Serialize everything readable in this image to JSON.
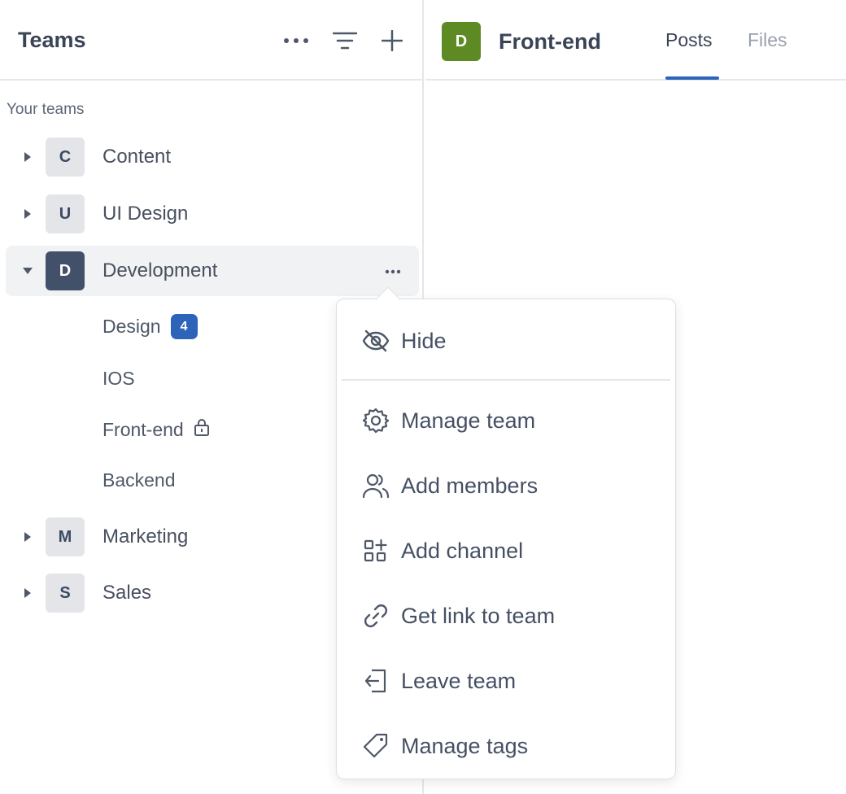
{
  "sidebar": {
    "title": "Teams",
    "section_label": "Your teams",
    "teams": [
      {
        "initial": "C",
        "name": "Content"
      },
      {
        "initial": "U",
        "name": "UI Design"
      },
      {
        "initial": "D",
        "name": "Development"
      },
      {
        "initial": "M",
        "name": "Marketing"
      },
      {
        "initial": "S",
        "name": "Sales"
      }
    ],
    "channels": [
      {
        "name": "Design",
        "badge": "4"
      },
      {
        "name": "IOS"
      },
      {
        "name": "Front-end",
        "locked": true
      },
      {
        "name": "Backend"
      }
    ]
  },
  "main": {
    "avatar_initial": "D",
    "title": "Front-end",
    "tabs": [
      {
        "label": "Posts",
        "active": true
      },
      {
        "label": "Files",
        "active": false
      }
    ]
  },
  "context_menu": {
    "items": [
      {
        "label": "Hide",
        "icon": "eye-off-icon"
      },
      {
        "label": "Manage team",
        "icon": "gear-icon"
      },
      {
        "label": "Add members",
        "icon": "people-icon"
      },
      {
        "label": "Add channel",
        "icon": "add-grid-icon"
      },
      {
        "label": "Get link to team",
        "icon": "link-icon"
      },
      {
        "label": "Leave team",
        "icon": "leave-icon"
      },
      {
        "label": "Manage tags",
        "icon": "tag-icon"
      }
    ]
  },
  "colors": {
    "accent": "#2d64ba",
    "team_avatar_active": "#43506a",
    "channel_avatar": "#5d8a22",
    "text": "#424c5f",
    "border": "#e4e7eb"
  }
}
